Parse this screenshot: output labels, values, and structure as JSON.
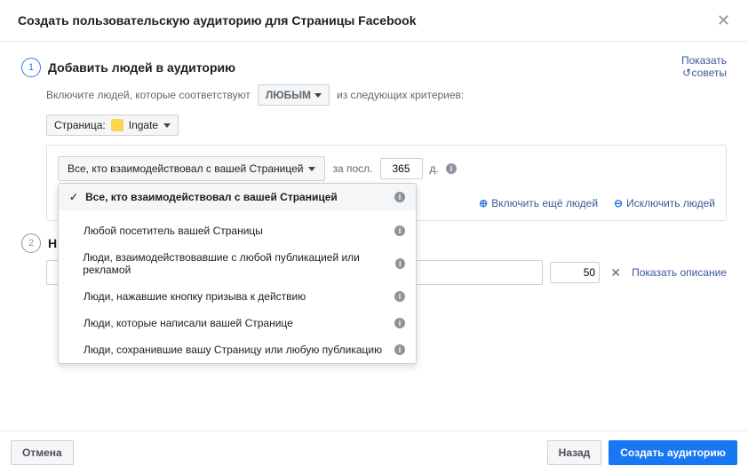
{
  "header": {
    "title": "Создать пользовательскую аудиторию для Страницы Facebook"
  },
  "hint": {
    "line1": "Показать",
    "line2": "советы"
  },
  "step1": {
    "num": "1",
    "title": "Добавить людей в аудиторию",
    "includeText": "Включите людей, которые соответствуют",
    "afterText": "из следующих критериев:",
    "anyLabel": "ЛЮБЫМ",
    "pageLabel": "Страница:",
    "pageName": "Ingate",
    "selectedAction": "Все, кто взаимодействовал с вашей Страницей",
    "lastLabel": "за посл.",
    "daysValue": "365",
    "daysSuffix": "д.",
    "menu": [
      "Все, кто взаимодействовал с вашей Страницей",
      "Любой посетитель вашей Страницы",
      "Люди, взаимодействовавшие с любой публикацией или рекламой",
      "Люди, нажавшие кнопку призыва к действию",
      "Люди, которые написали вашей Странице",
      "Люди, сохранившие вашу Страницу или любую публикацию"
    ],
    "includeMore": "Включить ещё людей",
    "exclude": "Исключить людей"
  },
  "step2": {
    "num": "2",
    "title": "Н",
    "value": "50",
    "showDesc": "Показать описание"
  },
  "footer": {
    "cancel": "Отмена",
    "back": "Назад",
    "create": "Создать аудиторию"
  }
}
